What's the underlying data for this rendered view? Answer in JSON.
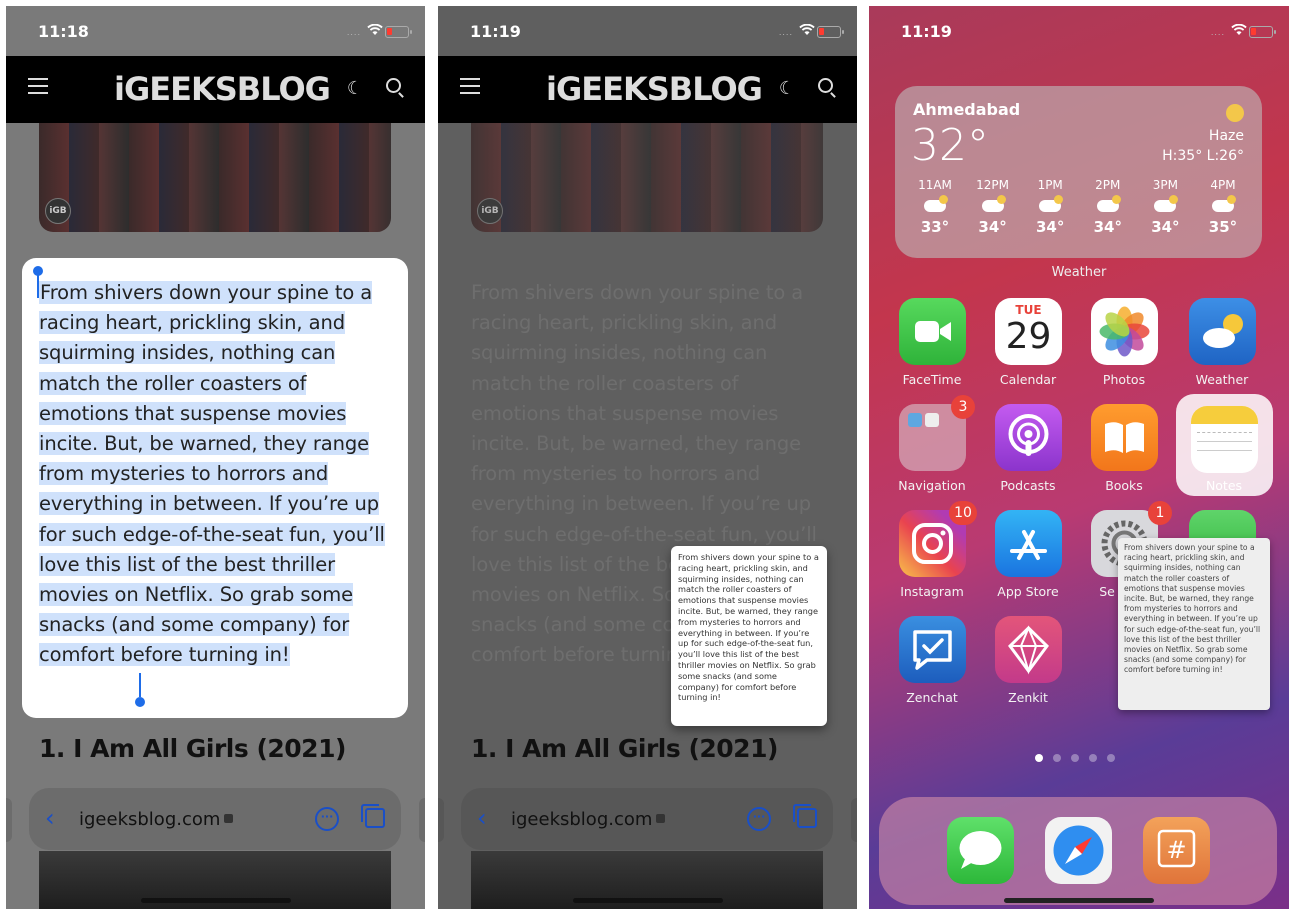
{
  "status": {
    "time1": "11:18",
    "time2": "11:19",
    "time3": "11:19",
    "signal": "....",
    "wifi": "wifi-icon",
    "battery_color": "#ff3b30"
  },
  "site": {
    "logo": "iGEEKSBLOG",
    "banner_badge": "iGB",
    "article_text": "From shivers down your spine to a racing heart, prickling skin, and squirming insides, nothing can match the roller coasters of emotions that suspense movies incite. But, be warned, they range from mysteries to horrors and everything in between. If you’re up for such edge-of-the-seat fun, you’ll love this list of the best thriller movies on Netflix. So grab some snacks (and some company) for comfort before turning in!",
    "heading": "1. I Am All Girls (2021)",
    "url": "igeeksblog.com",
    "back_glyph": "‹",
    "more_glyph": "···",
    "accent": "#1e6ce8"
  },
  "weather": {
    "city": "Ahmedabad",
    "temp": "32°",
    "condition": "Haze",
    "high_low": "H:35° L:26°",
    "label": "Weather",
    "hours": [
      {
        "time": "11AM",
        "temp": "33°"
      },
      {
        "time": "12PM",
        "temp": "34°"
      },
      {
        "time": "1PM",
        "temp": "34°"
      },
      {
        "time": "2PM",
        "temp": "34°"
      },
      {
        "time": "3PM",
        "temp": "34°"
      },
      {
        "time": "4PM",
        "temp": "35°"
      }
    ]
  },
  "apps": {
    "facetime": "FaceTime",
    "calendar": "Calendar",
    "calendar_day": "TUE",
    "calendar_date": "29",
    "photos": "Photos",
    "weather": "Weather",
    "navigation": "Navigation",
    "navigation_badge": "3",
    "podcasts": "Podcasts",
    "books": "Books",
    "notes": "Notes",
    "instagram": "Instagram",
    "instagram_badge": "10",
    "appstore": "App Store",
    "settings_partial": "Se",
    "settings_badge": "1",
    "zenchat": "Zenchat",
    "zenkit": "Zenkit"
  }
}
